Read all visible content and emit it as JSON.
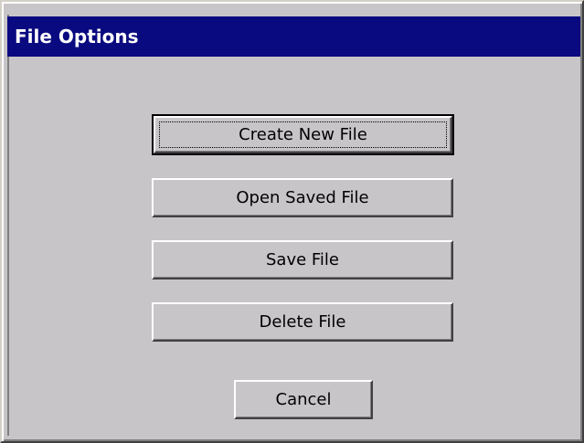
{
  "dialog": {
    "title": "File Options"
  },
  "buttons": {
    "create_new": "Create New File",
    "open_saved": "Open Saved File",
    "save": "Save File",
    "delete": "Delete File",
    "cancel": "Cancel"
  },
  "colors": {
    "title_bar": "#0a0a80",
    "face": "#c8c5c8",
    "title_text": "#ffffff"
  }
}
